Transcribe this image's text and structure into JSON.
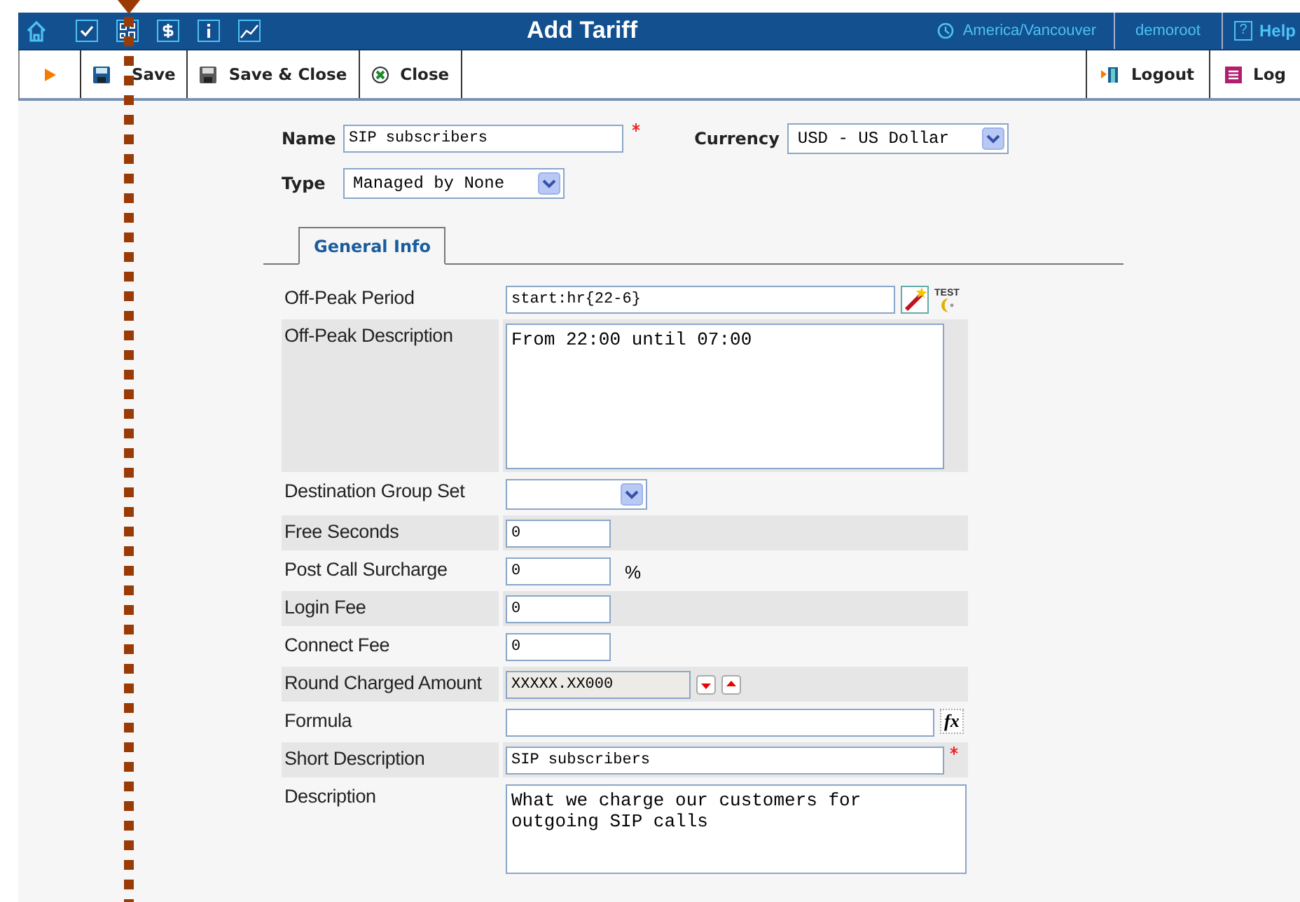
{
  "topbar": {
    "title": "Add Tariff",
    "timezone": "America/Vancouver",
    "user": "demoroot",
    "help": "Help",
    "help_icon": "?"
  },
  "toolbar": {
    "left": [
      {
        "label": "Save",
        "kind": "save"
      },
      {
        "label": "Save & Close",
        "kind": "save-close"
      },
      {
        "label": "Close",
        "kind": "close"
      }
    ],
    "right": [
      {
        "label": "Logout",
        "kind": "logout"
      },
      {
        "label": "Log",
        "kind": "log"
      }
    ]
  },
  "header_fields": [
    {
      "label": "Name",
      "kind": "text",
      "value": "SIP subscribers",
      "required": true
    },
    {
      "label": "Currency",
      "kind": "select",
      "value": "USD - US Dollar",
      "required": false
    },
    {
      "label": "Type",
      "kind": "select",
      "value": "Managed by None",
      "required": false
    }
  ],
  "tabs": [
    {
      "label": "General Info",
      "selected": true
    }
  ],
  "fields": [
    {
      "label": "Off-Peak Period",
      "kind": "wizard",
      "value": "start:hr{22-6}",
      "test_label": "TEST"
    },
    {
      "label": "Off-Peak Description",
      "kind": "textarea",
      "value": "From 22:00 until 07:00"
    },
    {
      "label": "Destination Group Set",
      "kind": "select"
    },
    {
      "label": "Free Seconds",
      "kind": "text",
      "value": "0"
    },
    {
      "label": "Post Call Surcharge",
      "kind": "text",
      "value": "0",
      "suffix": "%"
    },
    {
      "label": "Login Fee",
      "kind": "text",
      "value": "0"
    },
    {
      "label": "Connect Fee",
      "kind": "text",
      "value": "0"
    },
    {
      "label": "Round Charged Amount",
      "kind": "round",
      "value": "XXXXX.XX000",
      "disabled": true
    },
    {
      "label": "Formula",
      "kind": "formula",
      "icon_text": "fx"
    },
    {
      "label": "Short Description",
      "kind": "wide",
      "value": "SIP subscribers",
      "required": true
    },
    {
      "label": "Description",
      "kind": "textarea-wide",
      "value": "What we charge our customers for\noutgoing SIP calls"
    }
  ]
}
